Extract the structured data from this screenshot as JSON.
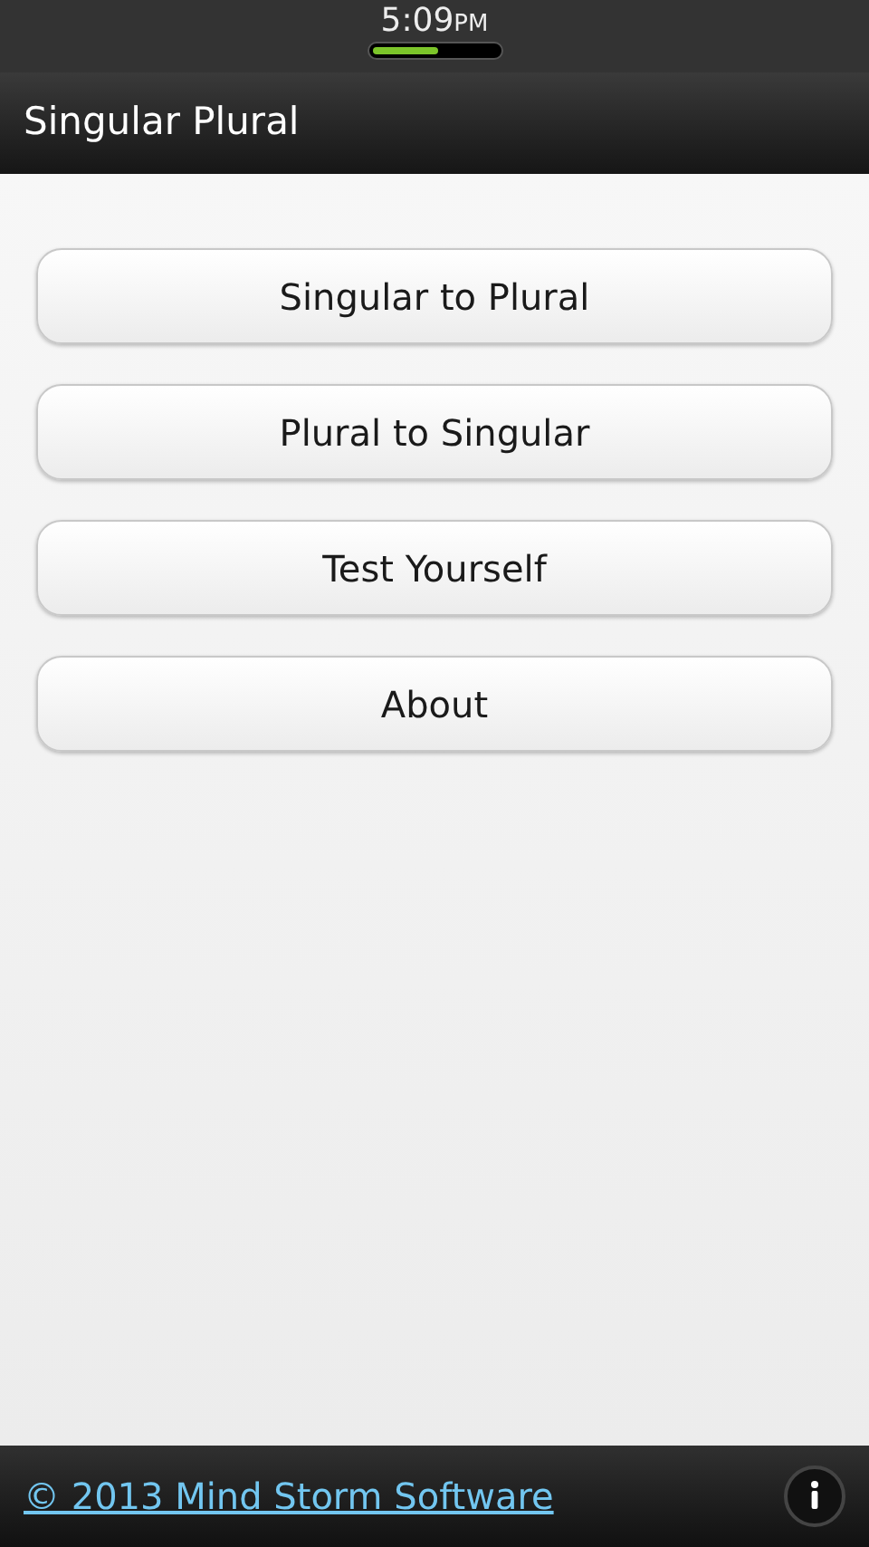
{
  "status_bar": {
    "time": "5:09",
    "period": "PM"
  },
  "title_bar": {
    "title": "Singular Plural"
  },
  "menu_buttons": [
    {
      "label": "Singular to Plural"
    },
    {
      "label": "Plural to Singular"
    },
    {
      "label": "Test Yourself"
    },
    {
      "label": "About"
    }
  ],
  "footer": {
    "link": "© 2013 Mind Storm Software"
  }
}
